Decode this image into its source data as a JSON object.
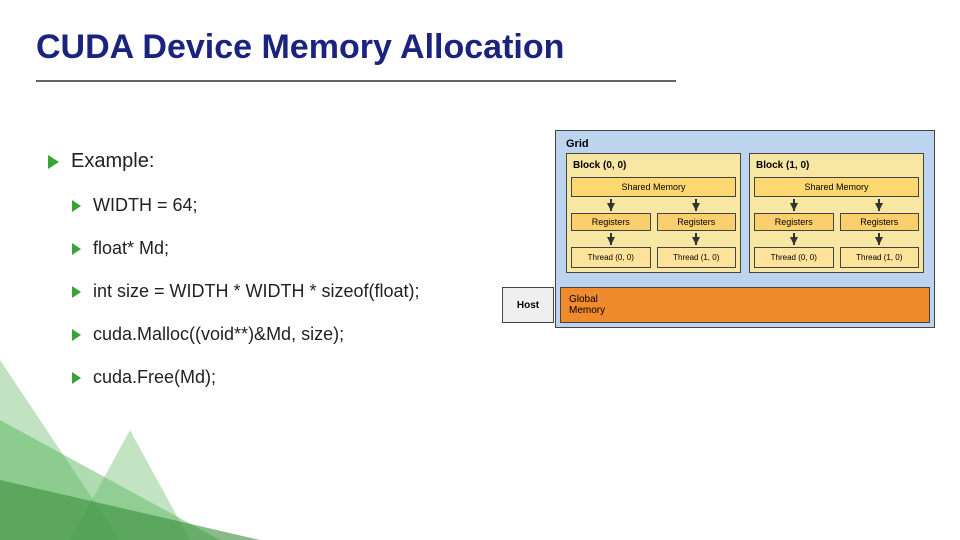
{
  "title": "CUDA Device Memory Allocation",
  "bullets": {
    "main": "Example:",
    "subs": [
      "WIDTH = 64;",
      "float* Md;",
      "int size = WIDTH * WIDTH * sizeof(float);",
      "cuda.Malloc((void**)&Md, size);",
      "cuda.Free(Md);"
    ]
  },
  "diagram": {
    "grid_label": "Grid",
    "blocks": [
      {
        "label": "Block (0, 0)",
        "shared": "Shared Memory",
        "regs": [
          "Registers",
          "Registers"
        ],
        "threads": [
          "Thread (0, 0)",
          "Thread (1, 0)"
        ]
      },
      {
        "label": "Block (1, 0)",
        "shared": "Shared Memory",
        "regs": [
          "Registers",
          "Registers"
        ],
        "threads": [
          "Thread (0, 0)",
          "Thread (1, 0)"
        ]
      }
    ],
    "host_label": "Host",
    "global_label": "Global\nMemory"
  }
}
